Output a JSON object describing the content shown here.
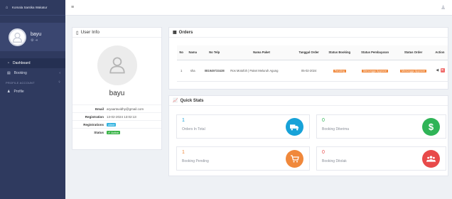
{
  "brand": {
    "title": "Komala Santika Wakatur"
  },
  "user_panel": {
    "name": "bayu"
  },
  "sidebar": {
    "items": [
      {
        "label": "Dashboard"
      },
      {
        "label": "Booking"
      }
    ],
    "header": "PROFILE ACCOUNT",
    "profile_label": "Profile"
  },
  "user_info": {
    "title": "User Info",
    "name": "bayu",
    "rows": [
      {
        "label": "Email",
        "value": "aryaartavidhy@gmail.com"
      },
      {
        "label": "Registration",
        "value": "13-02-2024 13:02:13"
      },
      {
        "label": "Registrations",
        "value": "client"
      },
      {
        "label": "Status",
        "value": "✔ Active"
      }
    ]
  },
  "orders": {
    "title": "Orders",
    "columns": [
      "No",
      "Nama",
      "No Telp",
      "Nama Paket",
      "Tanggal Order",
      "Status Booking",
      "Status Pembayaran",
      "Status Order",
      "Action"
    ],
    "rows": [
      {
        "no": "1",
        "nama": "sha",
        "telp": "081949733438",
        "paket": "Ros Motofoh | Paket Meluruh Agung",
        "tanggal": "05-02-2024",
        "status_booking": "Pending",
        "status_pembayaran": "Menunggu Approve",
        "status_order": "Menunggu Approve"
      }
    ]
  },
  "quick_stats": {
    "title": "Quick Stats",
    "boxes": [
      {
        "value": "1",
        "label": "Orders In Total",
        "color": "#17a2d8",
        "icon": "truck-icon"
      },
      {
        "value": "0",
        "label": "Booking Diterima",
        "color": "#2fb457",
        "icon": "dollar-icon"
      },
      {
        "value": "1",
        "label": "Booking Pending",
        "color": "#f0883b",
        "icon": "cart-icon"
      },
      {
        "value": "0",
        "label": "Booking Ditolak",
        "color": "#e84a4a",
        "icon": "users-icon"
      }
    ]
  }
}
